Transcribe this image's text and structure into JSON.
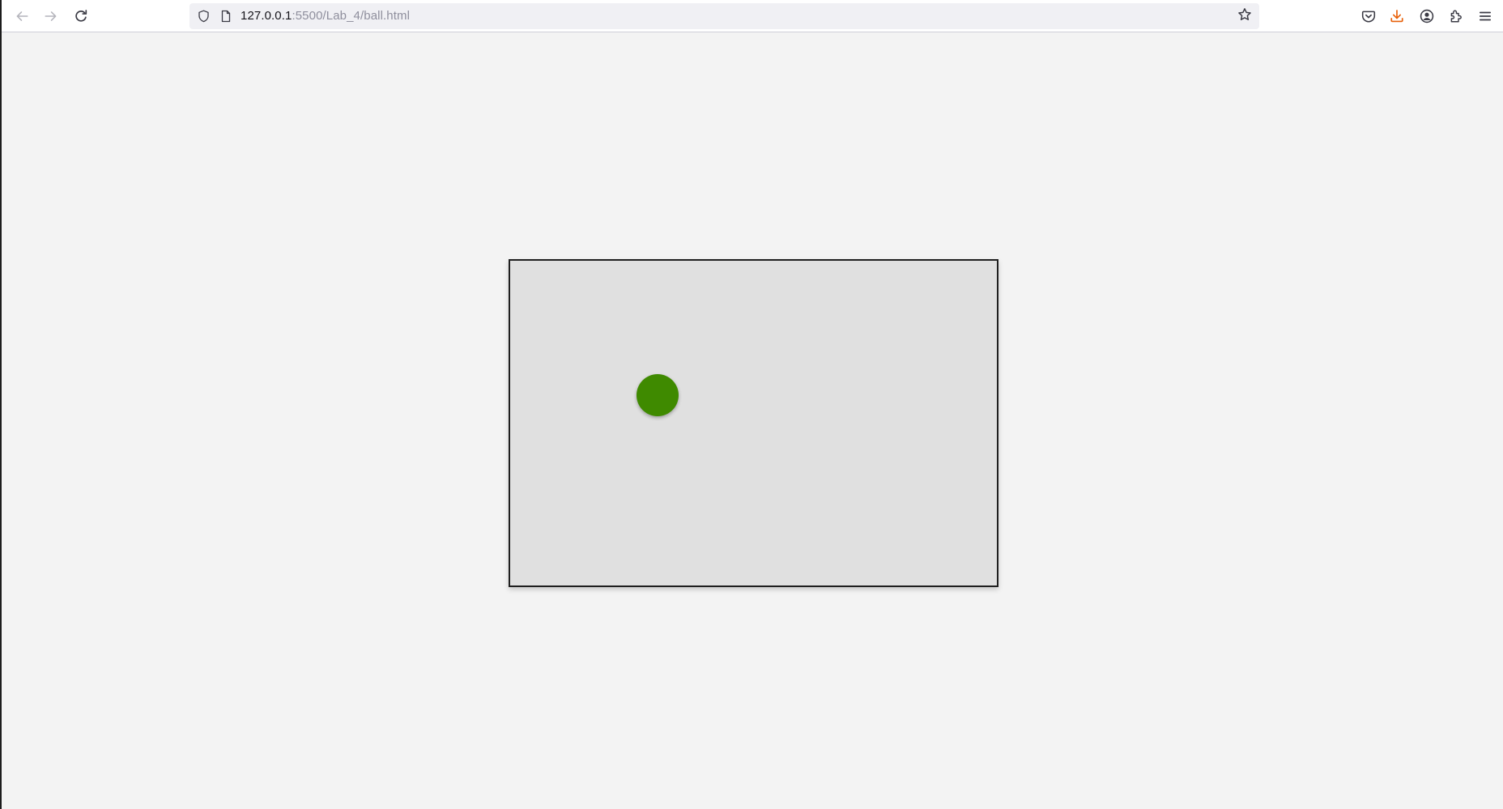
{
  "browser": {
    "url": {
      "host": "127.0.0.1",
      "path": ":5500/Lab_4/ball.html"
    },
    "icons": {
      "back": "arrow-left-icon",
      "forward": "arrow-right-icon",
      "reload": "reload-icon",
      "shield": "tracking-protection-shield-icon",
      "page": "page-info-icon",
      "bookmark": "star-icon",
      "pocket": "pocket-icon",
      "downloads": "download-icon",
      "account": "account-icon",
      "extensions": "extensions-icon",
      "menu": "hamburger-menu-icon"
    },
    "colors": {
      "toolbar_bg": "#ffffff",
      "urlbar_bg": "#f0f0f4",
      "download_accent": "#e8610a"
    }
  },
  "page": {
    "background": "#f3f3f3",
    "stage": {
      "background": "#e0e0e0",
      "border_color": "#1f1f1f"
    },
    "ball": {
      "color": "#3f8a00"
    }
  }
}
